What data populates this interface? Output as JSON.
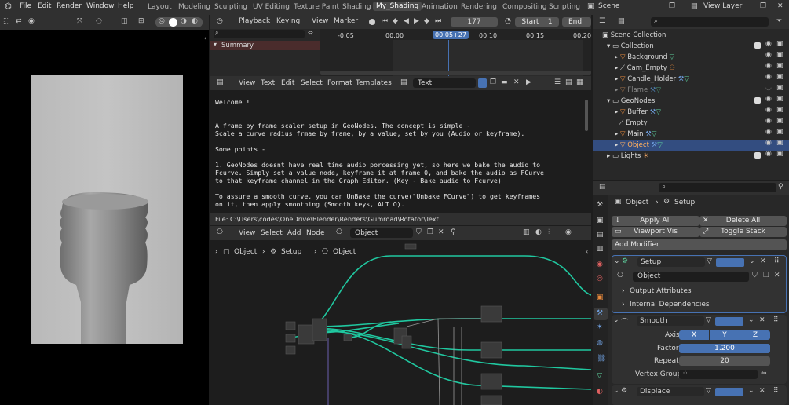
{
  "topbar": {
    "menus": [
      "File",
      "Edit",
      "Render",
      "Window",
      "Help"
    ],
    "workspaces": [
      "Layout",
      "Modeling",
      "Sculpting",
      "UV Editing",
      "Texture Paint",
      "Shading",
      "My_Shading",
      "Animation",
      "Rendering",
      "Compositing",
      "Scripting"
    ],
    "active_workspace": "My_Shading",
    "scene_name": "Scene",
    "view_layer": "View Layer"
  },
  "timeline": {
    "menus": [
      "Playback",
      "Keying",
      "View",
      "Marker"
    ],
    "current_frame": "177",
    "start_label": "Start",
    "start_value": "1",
    "end_label": "End",
    "ruler": [
      "-0:05",
      "00:00",
      "00:05+27",
      "00:10",
      "00:15",
      "00:20"
    ],
    "summary_label": "Summary"
  },
  "text_editor": {
    "menus": [
      "View",
      "Text",
      "Edit",
      "Select",
      "Format",
      "Templates"
    ],
    "text_name": "Text",
    "lines": [
      "Welcome !",
      "",
      "",
      "A frame by frame scaler setup in GeoNodes. The concept is simple -",
      "Scale a curve radius frmae by frame, by a value, set by you (Audio or keyframe).",
      "",
      "Some points -",
      "",
      "1. GeoNodes doesnt have  real time audio porcessing yet, so here we bake the audio to",
      "Fcurve. Simply set a value node, keyframe it at frame 0, and bake the audio as FCurve",
      "to that keyframe channel in the Graph Editor. (Key - Bake audio to Fcurve)",
      "",
      "To assure a smooth curve, you can  UnBake the curve(\"Unbake FCurve\") to get keyframes",
      "on it, then apply smoothing (Smooth keys, ALT O)."
    ],
    "file_path": "File: C:\\Users\\codes\\OneDrive\\Blender\\Renders\\Gumroad\\Rotator\\Text"
  },
  "node_editor": {
    "menus": [
      "View",
      "Select",
      "Add",
      "Node"
    ],
    "object_name": "Object",
    "breadcrumb": [
      "Object",
      "Setup",
      "Object"
    ]
  },
  "outliner": {
    "root": "Scene Collection",
    "items": [
      {
        "label": "Collection",
        "depth": 1,
        "kind": "collection"
      },
      {
        "label": "Background",
        "depth": 2,
        "kind": "object"
      },
      {
        "label": "Cam_Empty",
        "depth": 2,
        "kind": "empty"
      },
      {
        "label": "Candle_Holder",
        "depth": 2,
        "kind": "object"
      },
      {
        "label": "Flame",
        "depth": 2,
        "kind": "object-dim"
      },
      {
        "label": "GeoNodes",
        "depth": 1,
        "kind": "collection"
      },
      {
        "label": "Buffer",
        "depth": 2,
        "kind": "object"
      },
      {
        "label": "Empty",
        "depth": 2,
        "kind": "empty"
      },
      {
        "label": "Main",
        "depth": 2,
        "kind": "object"
      },
      {
        "label": "Object",
        "depth": 2,
        "kind": "object-selected"
      },
      {
        "label": "Lights",
        "depth": 1,
        "kind": "collection"
      }
    ]
  },
  "properties": {
    "breadcrumb_object": "Object",
    "breadcrumb_modifier": "Setup",
    "apply_all": "Apply All",
    "delete_all": "Delete All",
    "viewport_vis": "Viewport Vis",
    "toggle_stack": "Toggle Stack",
    "add_modifier": "Add Modifier",
    "mod1_name": "Setup",
    "mod1_nodegroup": "Object",
    "output_attributes": "Output Attributes",
    "internal_dependencies": "Internal Dependencies",
    "mod2_name": "Smooth",
    "axis_label": "Axis",
    "axis_x": "X",
    "axis_y": "Y",
    "axis_z": "Z",
    "factor_label": "Factor",
    "factor_value": "1.200",
    "repeat_label": "Repeat",
    "repeat_value": "20",
    "vertex_group_label": "Vertex Group",
    "mod3_name": "Displace"
  },
  "colors": {
    "accent": "#4772b3",
    "active_ws": "#4a4a4a",
    "object_orange": "#e88a3c",
    "modifier_green": "#5fd3a0",
    "node_link": "#20c8a0"
  }
}
